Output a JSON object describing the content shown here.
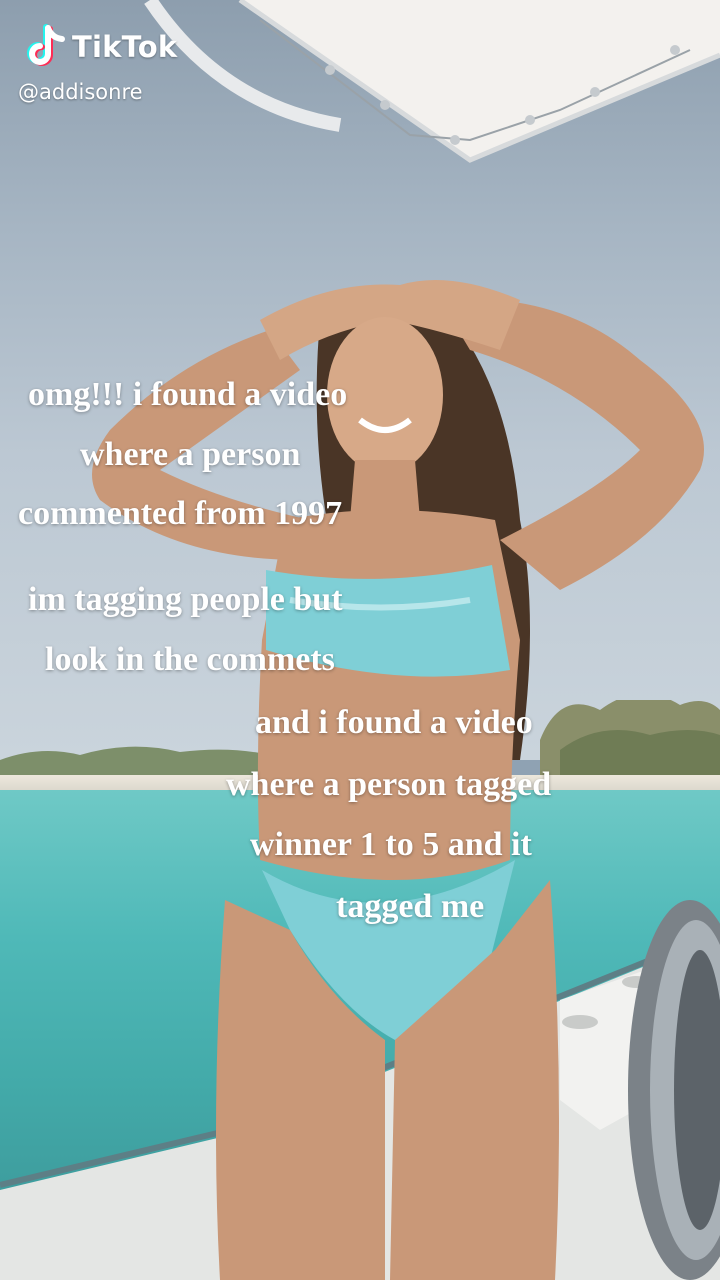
{
  "watermark": {
    "logo_icon": "tiktok-note-icon",
    "brand": "TikTok",
    "handle": "@addisonre"
  },
  "captions": [
    "omg!!! i found a video",
    "where a person",
    "commented from 1997",
    "im tagging people but",
    "look in the commets",
    "and i found a video",
    "where a person tagged",
    "winner 1 to 5 and it",
    "tagged me"
  ],
  "colors": {
    "caption": "#ffffff",
    "sea": "#4fb9b8",
    "sky": "#a6b5c3",
    "swimsuit": "#7fcfd6",
    "logo_cyan": "#25f4ee",
    "logo_red": "#fe2c55"
  }
}
